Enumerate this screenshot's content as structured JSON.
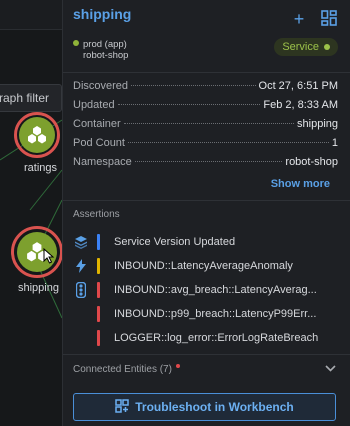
{
  "canvas": {
    "filter_text": "raph filter",
    "nodes": [
      {
        "label": "ratings"
      },
      {
        "label": "shipping"
      }
    ]
  },
  "panel": {
    "title": "shipping",
    "env_line1": "prod (app)",
    "env_line2": "robot-shop",
    "badge": "Service",
    "properties": [
      {
        "key": "Discovered",
        "value": "Oct 27, 6:51 PM"
      },
      {
        "key": "Updated",
        "value": "Feb 2, 8:33 AM"
      },
      {
        "key": "Container",
        "value": "shipping"
      },
      {
        "key": "Pod Count",
        "value": "1"
      },
      {
        "key": "Namespace",
        "value": "robot-shop"
      }
    ],
    "show_more": "Show more",
    "assertions_title": "Assertions",
    "assertions": [
      {
        "text": "Service Version Updated",
        "color": "#3b82f6",
        "icon": "layers-icon"
      },
      {
        "text": "INBOUND::LatencyAverageAnomaly",
        "color": "#e0b400",
        "icon": "bolt-icon"
      },
      {
        "text": "INBOUND::avg_breach::LatencyAverag...",
        "color": "#e0484b",
        "icon": "traffic-light-icon"
      },
      {
        "text": "INBOUND::p99_breach::LatencyP99Err...",
        "color": "#e0484b",
        "icon": ""
      },
      {
        "text": "LOGGER::log_error::ErrorLogRateBreach",
        "color": "#e0484b",
        "icon": ""
      }
    ],
    "connected_entities": "Connected Entities (7)",
    "troubleshoot_label": "Troubleshoot in Workbench"
  }
}
